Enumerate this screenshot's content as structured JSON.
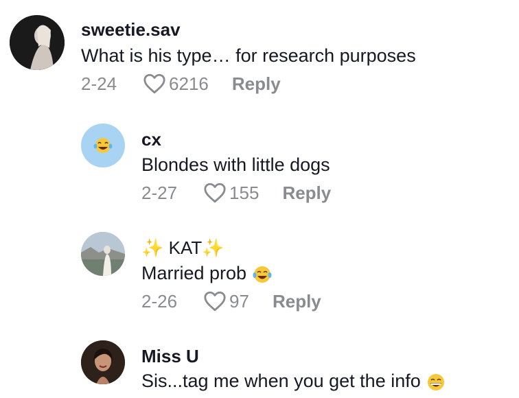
{
  "comments": [
    {
      "username": "sweetie.sav",
      "text": "What is his type… for research purposes",
      "date": "2-24",
      "likes": "6216",
      "reply_label": "Reply",
      "avatar": "profile-photo"
    },
    {
      "username": "cx",
      "text": "Blondes with little dogs",
      "date": "2-27",
      "likes": "155",
      "reply_label": "Reply",
      "avatar": "laughing-emoji-on-blue"
    },
    {
      "username": "✨ KAT✨",
      "text": "Married prob",
      "text_emoji": "face-with-tears-of-joy-icon",
      "date": "2-26",
      "likes": "97",
      "reply_label": "Reply",
      "avatar": "profile-photo"
    },
    {
      "username": "Miss U",
      "text": "Sis...tag me when you get the info",
      "text_emoji": "grinning-face-icon",
      "avatar": "profile-photo"
    }
  ],
  "colors": {
    "text": "#161823",
    "meta": "#8a8b91",
    "avatar_blue": "#a9d3f2"
  }
}
